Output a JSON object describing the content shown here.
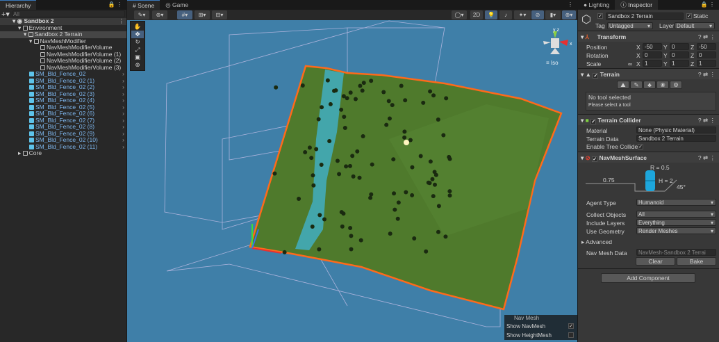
{
  "hierarchy": {
    "tab": "Hierarchy",
    "search_placeholder": "All",
    "scene": "Sandbox 2",
    "environment": "Environment",
    "terrain": "Sandbox 2 Terrain",
    "modifier": "NavMeshModifier",
    "volumes": [
      "NavMeshModifierVolume",
      "NavMeshModifierVolume (1)",
      "NavMeshModifierVolume (2)",
      "NavMeshModifierVolume (3)"
    ],
    "fences": [
      "SM_Bld_Fence_02",
      "SM_Bld_Fence_02 (1)",
      "SM_Bld_Fence_02 (2)",
      "SM_Bld_Fence_02 (3)",
      "SM_Bld_Fence_02 (4)",
      "SM_Bld_Fence_02 (5)",
      "SM_Bld_Fence_02 (6)",
      "SM_Bld_Fence_02 (7)",
      "SM_Bld_Fence_02 (8)",
      "SM_Bld_Fence_02 (9)",
      "SM_Bld_Fence_02 (10)",
      "SM_Bld_Fence_02 (11)"
    ],
    "core": "Core"
  },
  "scene": {
    "tabs": [
      "Scene",
      "Game"
    ],
    "toggle_2d": "2D",
    "iso_label": "Iso",
    "gizmo_axes": [
      "y",
      "z",
      "x"
    ],
    "overlay": {
      "title": "Nav Mesh",
      "show_navmesh": "Show NavMesh",
      "show_navmesh_checked": true,
      "show_heightmesh": "Show HeightMesh",
      "show_heightmesh_checked": false
    }
  },
  "inspector": {
    "tabs": [
      "Lighting",
      "Inspector"
    ],
    "object_name": "Sandbox 2 Terrain",
    "static_label": "Static",
    "tag_label": "Tag",
    "tag": "Untagged",
    "layer_label": "Layer",
    "layer": "Default",
    "transform": {
      "title": "Transform",
      "position_label": "Position",
      "rotation_label": "Rotation",
      "scale_label": "Scale",
      "position": [
        "-50",
        "0",
        "-50"
      ],
      "rotation": [
        "0",
        "0",
        "0"
      ],
      "scale": [
        "1",
        "1",
        "1"
      ],
      "axes": [
        "X",
        "Y",
        "Z"
      ]
    },
    "terrain": {
      "title": "Terrain",
      "no_tool": "No tool selected",
      "hint": "Please select a tool"
    },
    "collider": {
      "title": "Terrain Collider",
      "material_label": "Material",
      "material": "None (Physic Material)",
      "data_label": "Terrain Data",
      "data": "Sandbox 2 Terrain",
      "tree_label": "Enable Tree Colliders"
    },
    "navmesh": {
      "title": "NavMeshSurface",
      "r": "R = 0.5",
      "h": "H = 2",
      "step": "0.75",
      "slope": "45°",
      "agent_label": "Agent Type",
      "agent": "Humanoid",
      "collect_label": "Collect Objects",
      "collect": "All",
      "layers_label": "Include Layers",
      "layers": "Everything",
      "geometry_label": "Use Geometry",
      "geometry": "Render Meshes",
      "advanced": "Advanced",
      "data_label": "Nav Mesh Data",
      "data": "NavMesh-Sandbox 2 Terrai",
      "clear": "Clear",
      "bake": "Bake"
    },
    "add_component": "Add Component"
  },
  "colors": {
    "sky": "#3f7fa8",
    "terrain": "#4f7a2c",
    "outline": "#ff6a1a",
    "water": "#3fb6d6",
    "accent": "#3a79bb"
  }
}
